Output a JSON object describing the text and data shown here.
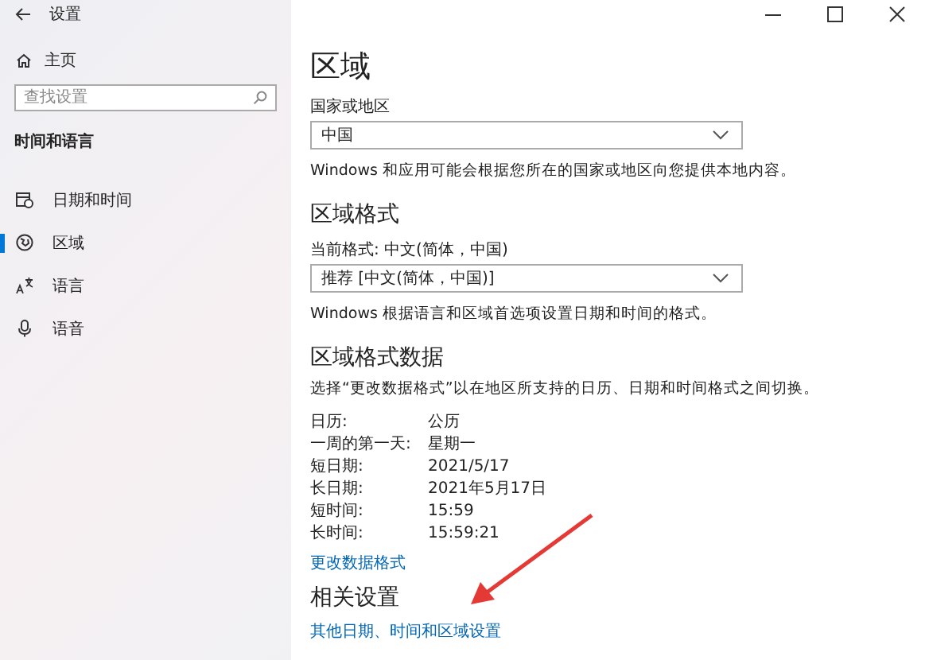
{
  "window": {
    "title": "设置"
  },
  "sidebar": {
    "home": "主页",
    "search": {
      "placeholder": "查找设置"
    },
    "section": "时间和语言",
    "items": [
      {
        "label": "日期和时间",
        "kind": "calendar",
        "selected": false
      },
      {
        "label": "区域",
        "kind": "globe",
        "selected": true
      },
      {
        "label": "语言",
        "kind": "language",
        "selected": false
      },
      {
        "label": "语音",
        "kind": "microphone",
        "selected": false
      }
    ]
  },
  "main": {
    "title": "区域",
    "country": {
      "label": "国家或地区",
      "value": "中国",
      "description": "Windows 和应用可能会根据您所在的国家或地区向您提供本地内容。"
    },
    "format": {
      "heading": "区域格式",
      "label": "当前格式: 中文(简体，中国)",
      "value": "推荐 [中文(简体，中国)]",
      "description": "Windows 根据语言和区域首选项设置日期和时间的格式。"
    },
    "format_data": {
      "heading": "区域格式数据",
      "description": "选择“更改数据格式”以在地区所支持的日历、日期和时间格式之间切换。",
      "rows": [
        {
          "label": "日历:",
          "value": "公历"
        },
        {
          "label": "一周的第一天:",
          "value": "星期一"
        },
        {
          "label": "短日期:",
          "value": "2021/5/17"
        },
        {
          "label": "长日期:",
          "value": "2021年5月17日"
        },
        {
          "label": "短时间:",
          "value": "15:59"
        },
        {
          "label": "长时间:",
          "value": "15:59:21"
        }
      ],
      "link": "更改数据格式"
    },
    "related": {
      "heading": "相关设置",
      "link": "其他日期、时间和区域设置"
    }
  }
}
